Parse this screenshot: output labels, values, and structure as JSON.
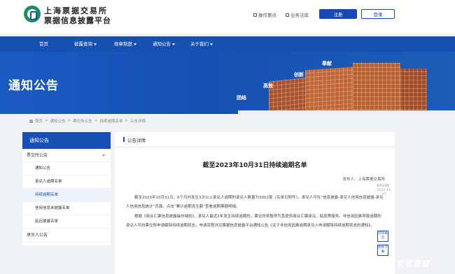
{
  "header": {
    "logo_line1": "上海票据交易所",
    "logo_line2": "票据信息披露平台",
    "ops_link": "操作要点",
    "biz_link": "业务法库",
    "register": "注册",
    "login": "登录"
  },
  "nav": {
    "items": [
      "首页",
      "披露查询",
      "规章制度",
      "通知公告",
      "关于我们"
    ]
  },
  "banner": {
    "title": "通知公告",
    "words": [
      "团结",
      "高效",
      "创新",
      "奉献"
    ]
  },
  "breadcrumb": [
    "首页",
    "通知公告",
    "票交所公告",
    "持续逾期名单",
    "公告详情"
  ],
  "sidebar": {
    "title": "通知公告",
    "items": [
      {
        "label": "票交所公告"
      },
      {
        "label": "通知公告"
      },
      {
        "label": "承兑人逾期名单"
      },
      {
        "label": "持续逾期名单"
      },
      {
        "label": "信用信息未披露名单"
      },
      {
        "label": "延迟披露名单"
      },
      {
        "label": "承兑人公告"
      }
    ]
  },
  "main": {
    "section": "公告详情",
    "title": "截至2023年10月31日持续逾期名单",
    "publisher": "发布人：上海票据交易所",
    "para1": "截至2023年10月31日，6个月内发生3次以上承兑人逾期的承兑人数量为3002家（名单见附件）。承兑人可在“信息披露-承兑人信用信息披露-承兑人信用信息统计”页面，点击“累计逾期发生额”查看逾期票据明细。",
    "para2": "根据《商业汇票信息披露操作细则》，承兑人最近2年发生持续逾期的，票交所将暂停为其提供商业汇票承兑、贴现等服务。非信用因素导致逾期的承兑人可向票交所申请解除持续逾期状态，申请流程详见票据信息披露平台通知公告《关于非信用因素逾期承兑人申请解除持续逾期状态的通知》。"
  },
  "rail": {
    "date": "发布日期：2023-11-07",
    "print": "打印本页",
    "download": "附件下载"
  },
  "watermark": "文化视窗"
}
